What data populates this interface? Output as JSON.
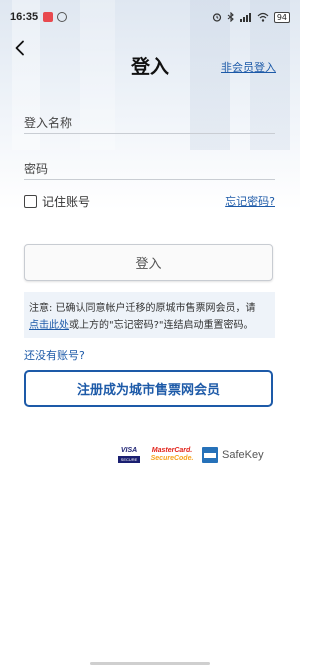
{
  "status_bar": {
    "time": "16:35",
    "battery": "94"
  },
  "header": {
    "title": "登入",
    "guest_login": "非会员登入"
  },
  "form": {
    "username_label": "登入名称",
    "password_label": "密码",
    "remember_label": "记住账号",
    "forgot_password": "忘记密码?",
    "login_button": "登入"
  },
  "notice": {
    "prefix": "注意: 已确认同意帐户迁移的原城市售票网会员，请",
    "link": "点击此处",
    "suffix": "或上方的\"忘记密码?\"连结启动重置密码。"
  },
  "register": {
    "no_account": "还没有账号?",
    "button": "注册成为城市售票网会员"
  },
  "payment_logos": {
    "visa_top": "VISA",
    "visa_bottom": "SECURE",
    "mastercard_line1": "MasterCard.",
    "mastercard_line2": "SecureCode.",
    "amex_safekey": "SafeKey"
  },
  "colors": {
    "link_blue": "#1d5aa8",
    "notice_bg": "#eef3f9"
  }
}
